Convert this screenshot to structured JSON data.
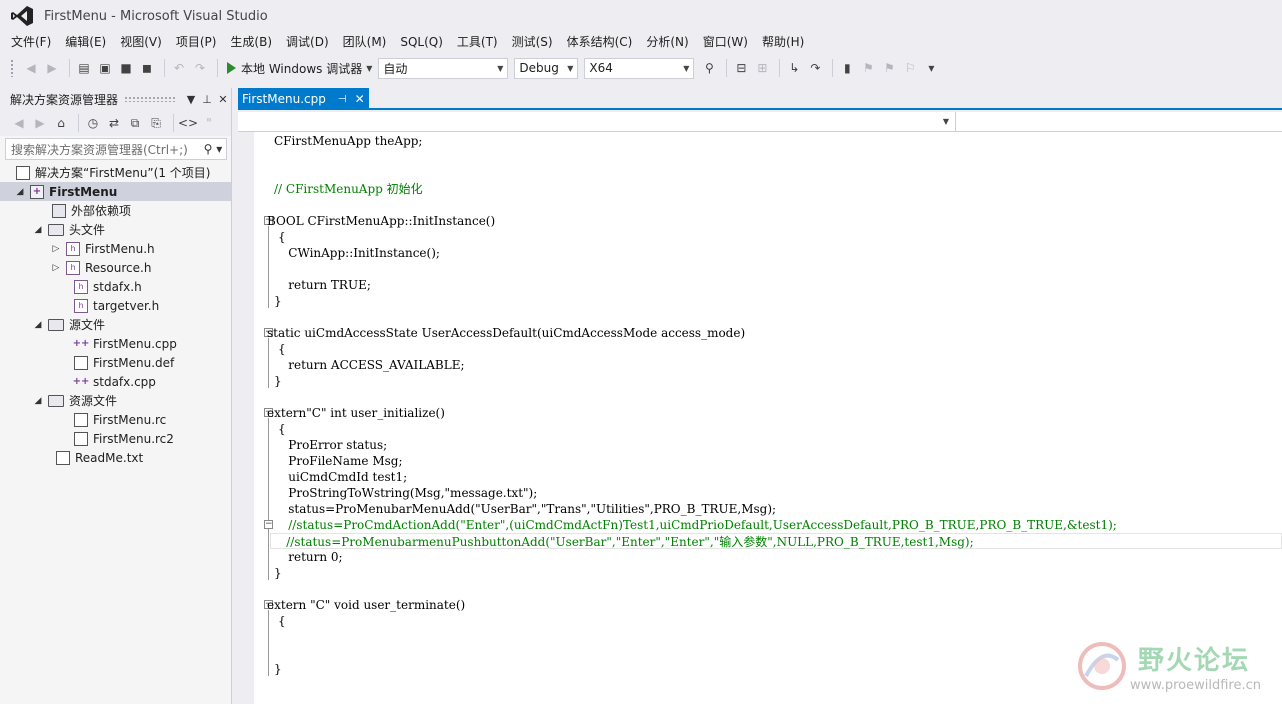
{
  "window": {
    "title": "FirstMenu - Microsoft Visual Studio"
  },
  "menu": [
    "文件(F)",
    "编辑(E)",
    "视图(V)",
    "项目(P)",
    "生成(B)",
    "调试(D)",
    "团队(M)",
    "SQL(Q)",
    "工具(T)",
    "测试(S)",
    "体系结构(C)",
    "分析(N)",
    "窗口(W)",
    "帮助(H)"
  ],
  "toolbar": {
    "run_label": "本地 Windows 调试器",
    "config_auto": "自动",
    "config_build": "Debug",
    "config_platform": "X64"
  },
  "solution_explorer": {
    "title": "解决方案资源管理器",
    "search_placeholder": "搜索解决方案资源管理器(Ctrl+;)",
    "tree": [
      {
        "label": "解决方案“FirstMenu”(1 个项目)",
        "icon": "solution-icon",
        "expander": ""
      },
      {
        "label": "FirstMenu",
        "icon": "project-icon",
        "expander": "◢"
      },
      {
        "label": "外部依赖项",
        "icon": "dependencies-icon",
        "expander": ""
      },
      {
        "label": "头文件",
        "icon": "folder-icon",
        "expander": "◢"
      },
      {
        "label": "FirstMenu.h",
        "icon": "header-file-icon",
        "expander": "▷"
      },
      {
        "label": "Resource.h",
        "icon": "header-file-icon",
        "expander": "▷"
      },
      {
        "label": "stdafx.h",
        "icon": "header-file-icon",
        "expander": ""
      },
      {
        "label": "targetver.h",
        "icon": "header-file-icon",
        "expander": ""
      },
      {
        "label": "源文件",
        "icon": "folder-icon",
        "expander": "◢"
      },
      {
        "label": "FirstMenu.cpp",
        "icon": "cpp-file-icon",
        "expander": ""
      },
      {
        "label": "FirstMenu.def",
        "icon": "def-file-icon",
        "expander": ""
      },
      {
        "label": "stdafx.cpp",
        "icon": "cpp-file-icon",
        "expander": ""
      },
      {
        "label": "资源文件",
        "icon": "folder-icon",
        "expander": "◢"
      },
      {
        "label": "FirstMenu.rc",
        "icon": "rc-file-icon",
        "expander": ""
      },
      {
        "label": "FirstMenu.rc2",
        "icon": "rc-file-icon",
        "expander": ""
      },
      {
        "label": "ReadMe.txt",
        "icon": "text-file-icon",
        "expander": ""
      }
    ]
  },
  "editor": {
    "tab_label": "FirstMenu.cpp",
    "code": [
      "CFirstMenuApp theApp;",
      "// CFirstMenuApp 初始化",
      "BOOL CFirstMenuApp::InitInstance()",
      "{",
      "    CWinApp::InitInstance();",
      "    return TRUE;",
      "}",
      "static uiCmdAccessState UserAccessDefault(uiCmdAccessMode access_mode)",
      "{",
      "    return ACCESS_AVAILABLE;",
      "}",
      "extern\"C\" int user_initialize()",
      "{",
      "    ProError status;",
      "    ProFileName Msg;",
      "    uiCmdCmdId test1;",
      "    ProStringToWstring(Msg,\"message.txt\");",
      "    status=ProMenubarMenuAdd(\"UserBar\",\"Trans\",\"Utilities\",PRO_B_TRUE,Msg);",
      "    //status=ProCmdActionAdd(\"Enter\",(uiCmdCmdActFn)Test1,uiCmdPrioDefault,UserAccessDefault,PRO_B_TRUE,PRO_B_TRUE,&test1);",
      "    //status=ProMenubarmenuPushbuttonAdd(\"UserBar\",\"Enter\",\"Enter\",\"输入参数\",NULL,PRO_B_TRUE,test1,Msg);",
      "    return 0;",
      "}",
      "extern \"C\" void user_terminate()",
      "{",
      "}"
    ]
  },
  "watermark": {
    "title": "野火论坛",
    "url": "www.proewildfire.cn"
  },
  "colors": {
    "accent": "#007acc",
    "keyword": "#0000ff",
    "string": "#a31515",
    "comment": "#008000"
  }
}
